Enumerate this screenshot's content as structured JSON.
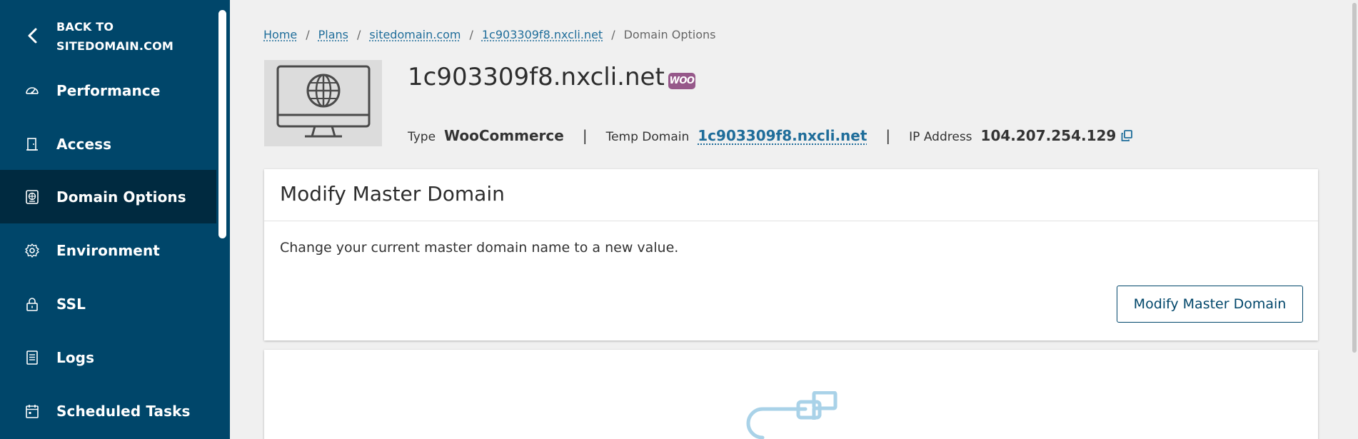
{
  "sidebar": {
    "back_label_line1": "BACK TO",
    "back_label_line2": "SITEDOMAIN.COM",
    "items": [
      {
        "label": "Performance",
        "icon": "speedometer-icon"
      },
      {
        "label": "Access",
        "icon": "door-icon"
      },
      {
        "label": "Domain Options",
        "icon": "globe-icon",
        "active": true
      },
      {
        "label": "Environment",
        "icon": "gear-icon"
      },
      {
        "label": "SSL",
        "icon": "lock-icon"
      },
      {
        "label": "Logs",
        "icon": "document-icon"
      },
      {
        "label": "Scheduled Tasks",
        "icon": "calendar-icon"
      }
    ]
  },
  "breadcrumb": {
    "items": [
      "Home",
      "Plans",
      "sitedomain.com",
      "1c903309f8.nxcli.net"
    ],
    "current": "Domain Options",
    "separator": "/"
  },
  "header": {
    "title": "1c903309f8.nxcli.net",
    "badge": "WOO",
    "type_label": "Type",
    "type_value": "WooCommerce",
    "temp_label": "Temp Domain",
    "temp_value": "1c903309f8.nxcli.net",
    "ip_label": "IP Address",
    "ip_value": "104.207.254.129",
    "divider": "|"
  },
  "card": {
    "title": "Modify Master Domain",
    "description": "Change your current master domain name to a new value.",
    "button_label": "Modify Master Domain"
  },
  "colors": {
    "sidebar_bg": "#00466a",
    "sidebar_active": "#002a40",
    "link": "#1f6d9a",
    "woo": "#96588a",
    "page_bg": "#f0f0f0"
  }
}
